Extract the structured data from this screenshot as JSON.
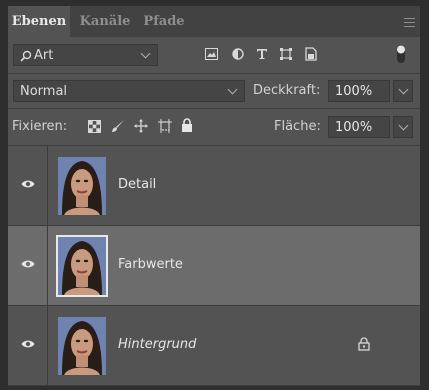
{
  "tabs": [
    {
      "label": "Ebenen",
      "active": true
    },
    {
      "label": "Kanäle",
      "active": false
    },
    {
      "label": "Pfade",
      "active": false
    }
  ],
  "filter": {
    "kind_label": "Art",
    "icons": [
      "image-filter-icon",
      "adjustment-filter-icon",
      "type-filter-icon",
      "shape-filter-icon",
      "smart-object-filter-icon",
      "filter-toggle-icon"
    ]
  },
  "blend": {
    "mode": "Normal",
    "opacity_label": "Deckkraft:",
    "opacity_value": "100%"
  },
  "lock": {
    "label": "Fixieren:",
    "fill_label": "Fläche:",
    "fill_value": "100%",
    "icons": [
      "lock-transparent-pixels-icon",
      "lock-image-pixels-icon",
      "lock-position-icon",
      "lock-artboard-icon",
      "lock-all-icon"
    ]
  },
  "layers": [
    {
      "name": "Detail",
      "visible": true,
      "selected": false,
      "italic": false,
      "locked": false
    },
    {
      "name": "Farbwerte",
      "visible": true,
      "selected": true,
      "italic": false,
      "locked": false
    },
    {
      "name": "Hintergrund",
      "visible": true,
      "selected": false,
      "italic": true,
      "locked": true
    }
  ],
  "colors": {
    "panel_bg": "#535353",
    "tabbar_bg": "#424242",
    "selected_layer_bg": "#6c6c6c",
    "text": "#e6e6e6"
  }
}
